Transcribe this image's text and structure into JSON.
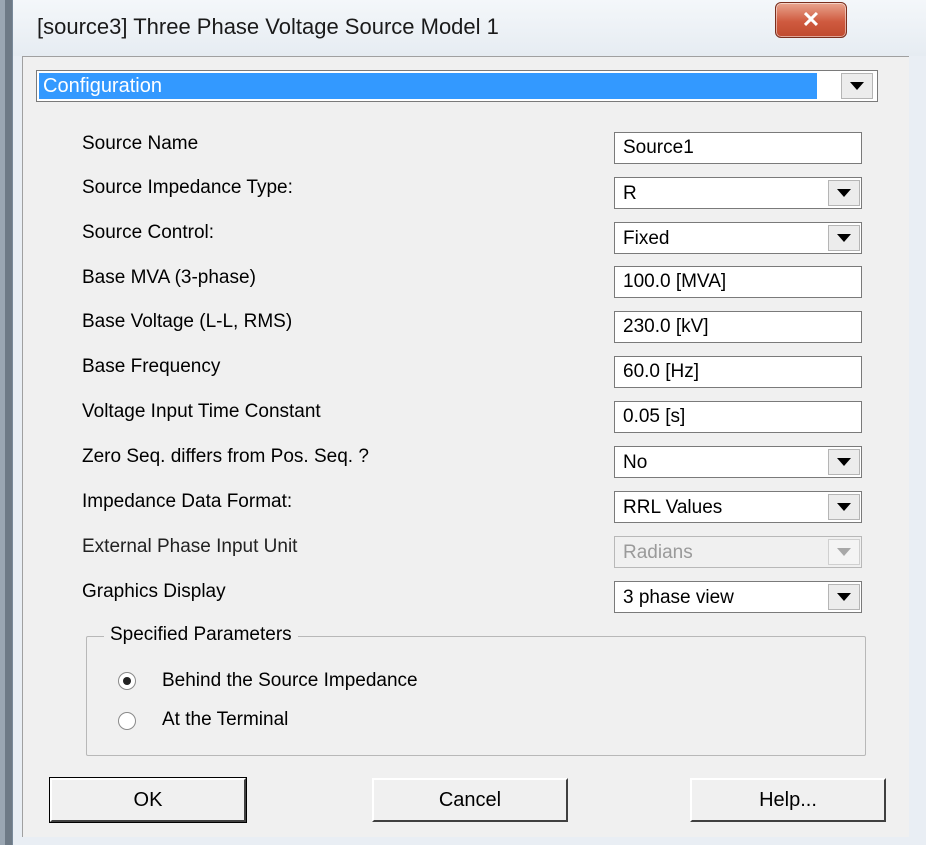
{
  "window": {
    "title": "[source3] Three Phase Voltage Source Model 1",
    "close_label": "✕"
  },
  "category": {
    "selected": "Configuration"
  },
  "fields": [
    {
      "label": "Source Name",
      "kind": "text",
      "value": "Source1"
    },
    {
      "label": "Source Impedance Type:",
      "kind": "combo",
      "value": "R"
    },
    {
      "label": "Source Control:",
      "kind": "combo",
      "value": "Fixed"
    },
    {
      "label": "Base MVA (3-phase)",
      "kind": "text",
      "value": "100.0 [MVA]"
    },
    {
      "label": "Base Voltage (L-L, RMS)",
      "kind": "text",
      "value": "230.0 [kV]"
    },
    {
      "label": "Base Frequency",
      "kind": "text",
      "value": "60.0 [Hz]"
    },
    {
      "label": "Voltage Input Time Constant",
      "kind": "text",
      "value": "0.05 [s]"
    },
    {
      "label": "Zero Seq. differs from Pos. Seq. ?",
      "kind": "combo",
      "value": "No"
    },
    {
      "label": "Impedance Data Format:",
      "kind": "combo",
      "value": "RRL Values"
    },
    {
      "label": "External Phase Input Unit",
      "kind": "combo",
      "value": "Radians",
      "disabled": true
    },
    {
      "label": "Graphics Display",
      "kind": "combo",
      "value": "3 phase view"
    }
  ],
  "specified_parameters": {
    "title": "Specified Parameters",
    "options": [
      {
        "label": "Behind the Source Impedance",
        "selected": true
      },
      {
        "label": "At the Terminal",
        "selected": false
      }
    ]
  },
  "buttons": {
    "ok": "OK",
    "cancel": "Cancel",
    "help": "Help..."
  }
}
